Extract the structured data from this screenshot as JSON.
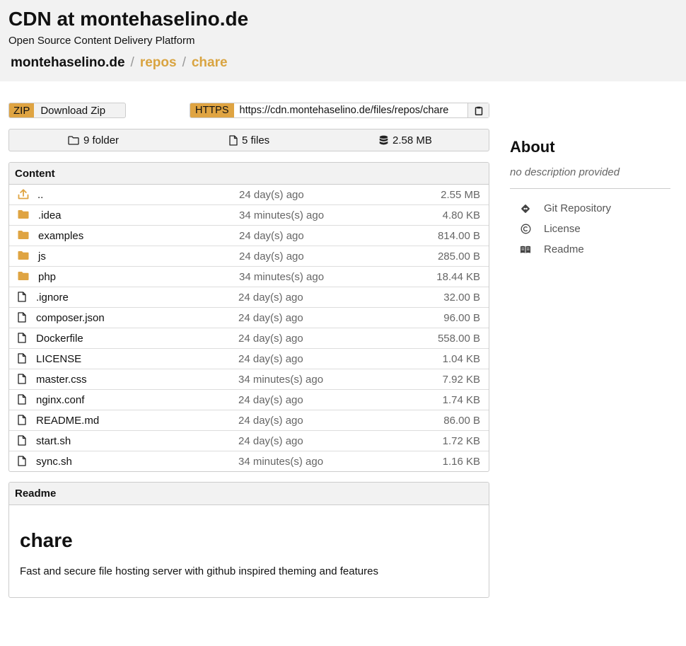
{
  "header": {
    "title": "CDN at montehaselino.de",
    "subtitle": "Open Source Content Delivery Platform",
    "breadcrumb": {
      "root": "montehaselino.de",
      "sep": "/",
      "items": [
        "repos",
        "chare"
      ]
    }
  },
  "toolbar": {
    "zip_tag": "ZIP",
    "zip_label": "Download Zip",
    "https_tag": "HTTPS",
    "clone_url": "https://cdn.montehaselino.de/files/repos/chare"
  },
  "stats": {
    "folders": "9 folder",
    "files": "5 files",
    "size": "2.58 MB"
  },
  "content": {
    "heading": "Content",
    "rows": [
      {
        "type": "up",
        "name": "..",
        "time": "24 day(s) ago",
        "size": "2.55 MB"
      },
      {
        "type": "folder",
        "name": ".idea",
        "time": "34 minutes(s) ago",
        "size": "4.80 KB"
      },
      {
        "type": "folder",
        "name": "examples",
        "time": "24 day(s) ago",
        "size": "814.00 B"
      },
      {
        "type": "folder",
        "name": "js",
        "time": "24 day(s) ago",
        "size": "285.00 B"
      },
      {
        "type": "folder",
        "name": "php",
        "time": "34 minutes(s) ago",
        "size": "18.44 KB"
      },
      {
        "type": "file",
        "name": ".ignore",
        "time": "24 day(s) ago",
        "size": "32.00 B"
      },
      {
        "type": "file",
        "name": "composer.json",
        "time": "24 day(s) ago",
        "size": "96.00 B"
      },
      {
        "type": "file",
        "name": "Dockerfile",
        "time": "24 day(s) ago",
        "size": "558.00 B"
      },
      {
        "type": "file",
        "name": "LICENSE",
        "time": "24 day(s) ago",
        "size": "1.04 KB"
      },
      {
        "type": "file",
        "name": "master.css",
        "time": "34 minutes(s) ago",
        "size": "7.92 KB"
      },
      {
        "type": "file",
        "name": "nginx.conf",
        "time": "24 day(s) ago",
        "size": "1.74 KB"
      },
      {
        "type": "file",
        "name": "README.md",
        "time": "24 day(s) ago",
        "size": "86.00 B"
      },
      {
        "type": "file",
        "name": "start.sh",
        "time": "24 day(s) ago",
        "size": "1.72 KB"
      },
      {
        "type": "file",
        "name": "sync.sh",
        "time": "34 minutes(s) ago",
        "size": "1.16 KB"
      }
    ]
  },
  "readme": {
    "heading": "Readme",
    "title": "chare",
    "description": "Fast and secure file hosting server with github inspired theming and features"
  },
  "about": {
    "title": "About",
    "description": "no description provided",
    "links": [
      {
        "icon": "git-icon",
        "label": "Git Repository"
      },
      {
        "icon": "copyright-icon",
        "label": "License"
      },
      {
        "icon": "book-icon",
        "label": "Readme"
      }
    ]
  },
  "colors": {
    "accent": "#dfa442",
    "link": "#d9a441",
    "header_bg": "#f2f2f2"
  }
}
